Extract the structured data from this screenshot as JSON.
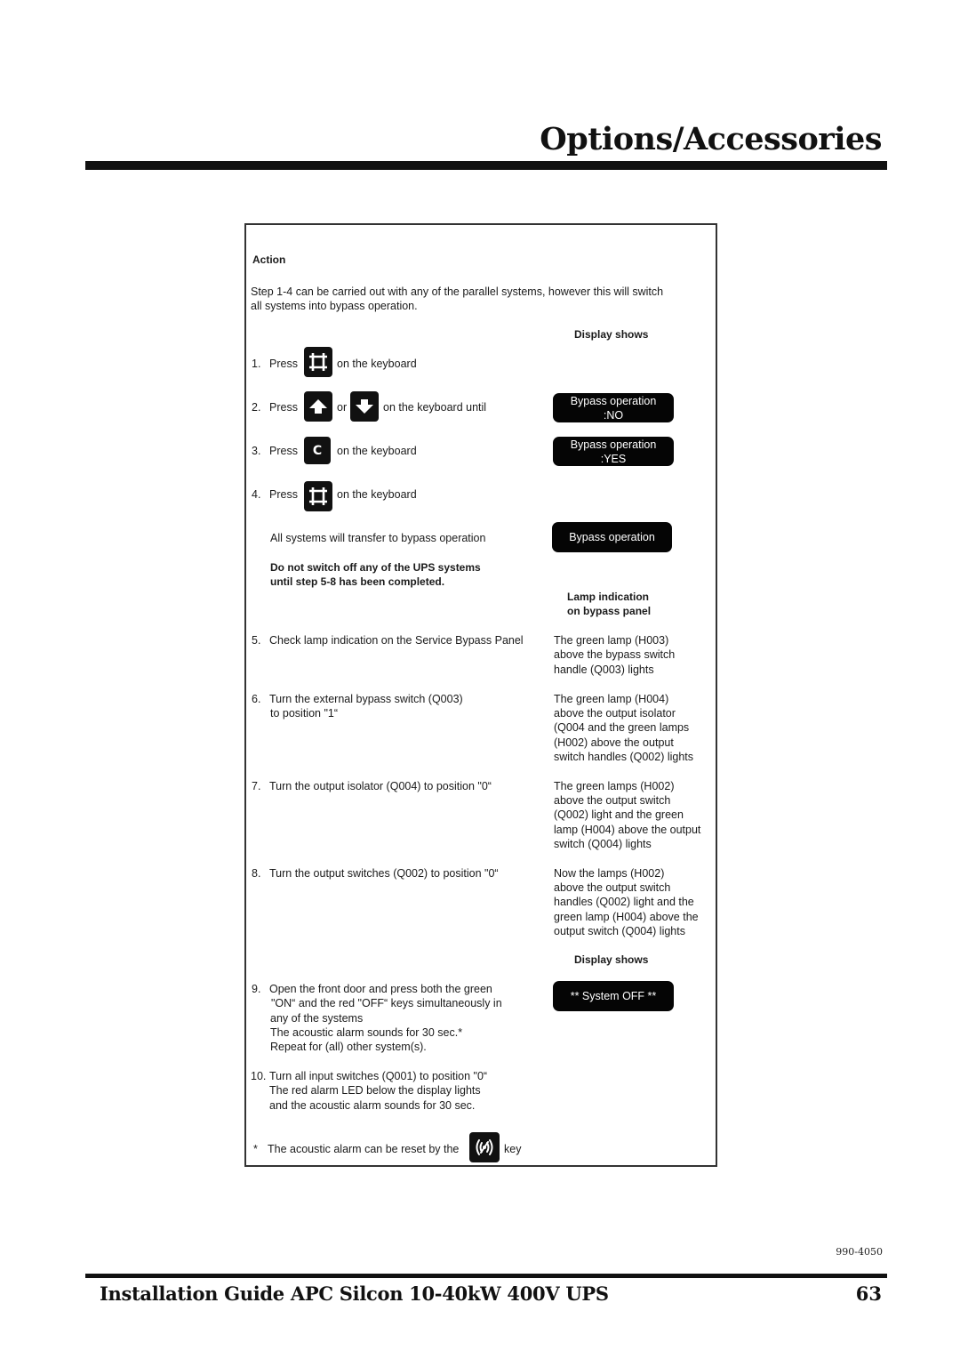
{
  "header": {
    "title": "Options/Accessories"
  },
  "procedure": {
    "action_heading": "Action",
    "intro": [
      "Step 1-4 can be carried out with any of the parallel systems, however this will switch",
      "all systems into bypass operation."
    ],
    "display_shows_heading": "Display shows",
    "steps_1_4": [
      {
        "num": "1.",
        "pre": "Press",
        "post": "on the keyboard",
        "key_icon": "enter-key-icon"
      },
      {
        "num": "2.",
        "pre": "Press",
        "mid": "or",
        "post": "on the keyboard until",
        "key_icons": [
          "up-arrow-key-icon",
          "down-arrow-key-icon"
        ]
      },
      {
        "num": "3.",
        "pre": "Press",
        "key_label": "C",
        "post": "on the keyboard"
      },
      {
        "num": "4.",
        "pre": "Press",
        "post": "on the keyboard",
        "key_icon": "enter-key-icon"
      }
    ],
    "displays": {
      "step2": [
        "Bypass operation",
        ":NO"
      ],
      "step3": [
        "Bypass operation",
        ":YES"
      ],
      "transfer": "Bypass operation",
      "system_off": "** System OFF **"
    },
    "transfer_note": "All systems will transfer to bypass operation",
    "warning": [
      "Do not switch off any of the UPS systems",
      "until step 5-8 has been completed."
    ],
    "lamp_heading": [
      "Lamp indication",
      "on bypass panel"
    ],
    "steps_5_8": [
      {
        "num": "5.",
        "action": [
          "Check lamp indication on the Service Bypass Panel"
        ],
        "lamp": [
          "The green lamp (H003)",
          "above the bypass switch",
          "handle (Q003) lights"
        ]
      },
      {
        "num": "6.",
        "action": [
          "Turn the external bypass switch (Q003)",
          "to position \"1“"
        ],
        "lamp": [
          "The green lamp (H004)",
          "above the output isolator",
          "(Q004 and the green lamps",
          "(H002) above the output",
          "switch handles (Q002) lights"
        ]
      },
      {
        "num": "7.",
        "action": [
          "Turn the output isolator (Q004) to position \"0“"
        ],
        "lamp": [
          "The green lamps (H002)",
          "above the output switch",
          "(Q002) light and the green",
          "lamp (H004) above the output",
          "switch (Q004) lights"
        ]
      },
      {
        "num": "8.",
        "action": [
          "Turn the output switches (Q002) to position \"0“"
        ],
        "lamp": [
          "Now the lamps (H002)",
          "above the output switch",
          "handles (Q002) light and the",
          "green lamp (H004) above the",
          "output switch (Q004) lights"
        ]
      }
    ],
    "display_shows_heading_2": "Display shows",
    "step9": {
      "num": "9.",
      "lines": [
        "Open the front door and press both the green",
        "\"ON“ and the red \"OFF“ keys simultaneously in",
        "any of the systems",
        "The acoustic alarm sounds for 30 sec.*",
        "Repeat for (all) other system(s)."
      ]
    },
    "step10": {
      "num": "10.",
      "lines": [
        "Turn all input switches (Q001) to position \"0“",
        "The red alarm LED below the display lights",
        "and the acoustic alarm sounds for 30 sec."
      ]
    },
    "footnote": {
      "marker": "*",
      "pre": "The acoustic alarm can be reset by the",
      "post": "key",
      "key_icon": "alarm-reset-key-icon"
    }
  },
  "footer": {
    "doc_number": "990-4050",
    "guide_title": "Installation Guide APC Silcon 10-40kW 400V UPS",
    "page_number": "63"
  }
}
